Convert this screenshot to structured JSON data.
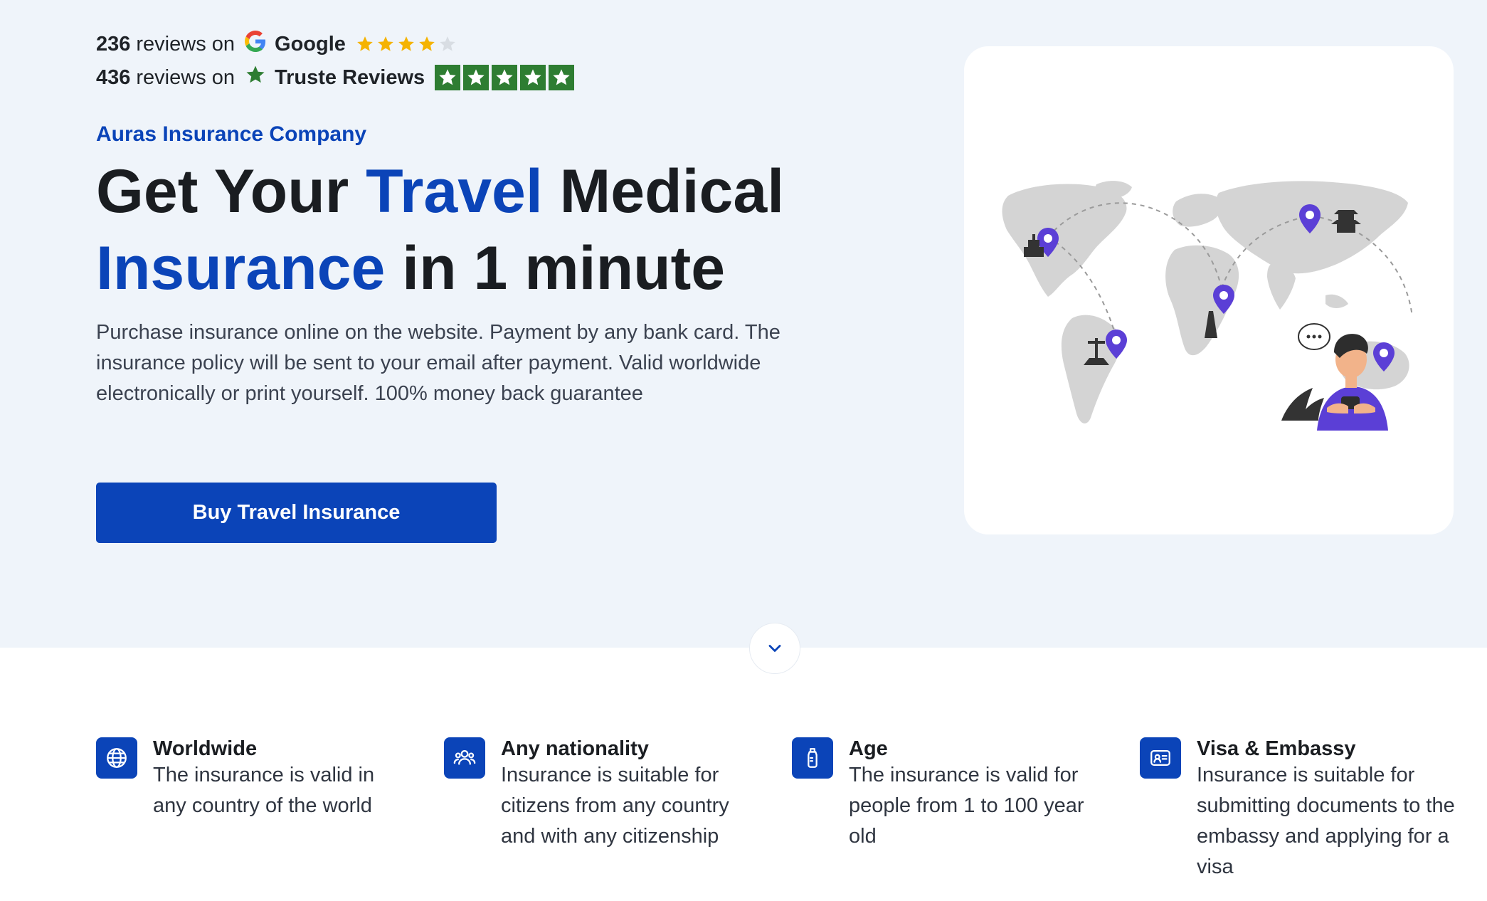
{
  "reviews": [
    {
      "count": "236",
      "on_text": "reviews on",
      "brand": "Google",
      "rating_stars": 4,
      "max_stars": 5,
      "icon": "google-g-icon"
    },
    {
      "count": "436",
      "on_text": "reviews on",
      "brand": "Truste Reviews",
      "rating_stars": 5,
      "max_stars": 5,
      "icon": "green-star-icon"
    }
  ],
  "hero": {
    "company": "Auras Insurance Company",
    "headline": {
      "part1": "Get Your ",
      "accent1": "Travel",
      "part2": " Medical",
      "accent2": "Insurance",
      "part3": " in 1 minute"
    },
    "description": "Purchase insurance online on the website. Payment by any bank card. The insurance policy will be sent to your email after payment. Valid worldwide electronically or print yourself. 100% money back guarantee",
    "cta_label": "Buy Travel Insurance"
  },
  "features": [
    {
      "icon": "globe-icon",
      "title": "Worldwide",
      "description": "The insurance is valid in any country of the world"
    },
    {
      "icon": "users-icon",
      "title": "Any nationality",
      "description": "Insurance is suitable for citizens from any country and with any citizenship"
    },
    {
      "icon": "baby-bottle-icon",
      "title": "Age",
      "description": "The insurance is valid for people from 1 to 100 year old"
    },
    {
      "icon": "id-card-icon",
      "title": "Visa & Embassy",
      "description": "Insurance is suitable for submitting documents to the embassy and applying for a visa"
    }
  ],
  "colors": {
    "brand": "#0b44b8",
    "hero_bg": "#eff4fa",
    "trustpilot_green": "#2e7d32",
    "google_star": "#f5b301"
  }
}
